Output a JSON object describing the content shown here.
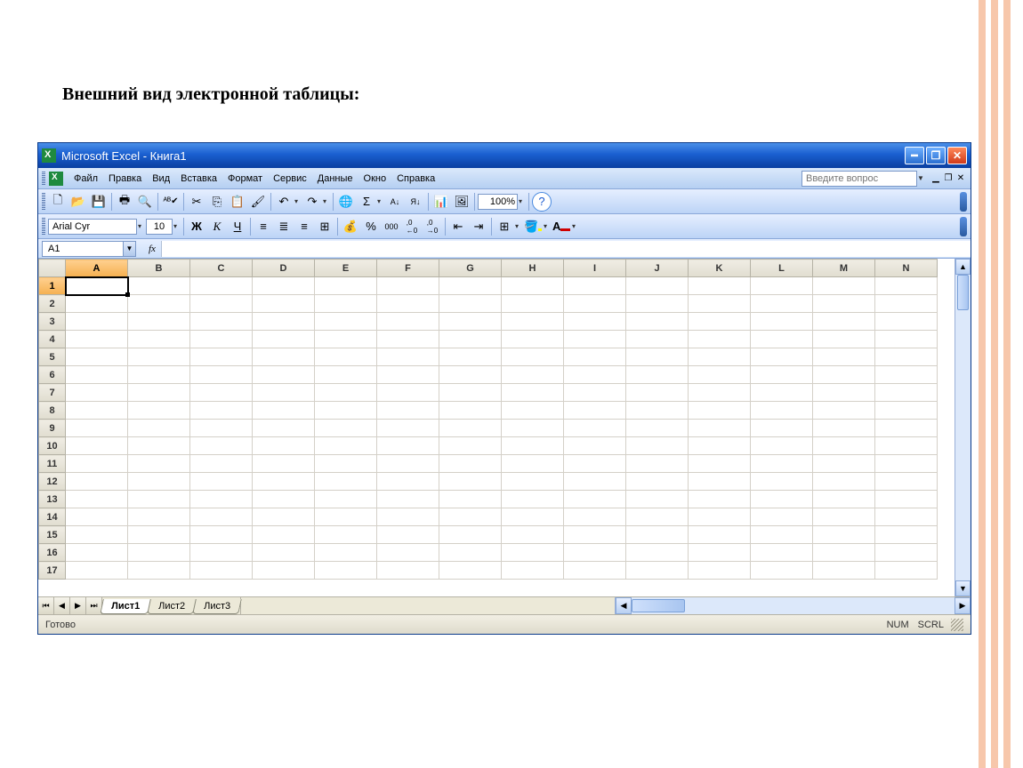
{
  "page_heading": "Внешний вид электронной таблицы:",
  "window": {
    "title": "Microsoft Excel - Книга1"
  },
  "menus": {
    "file": "Файл",
    "edit": "Правка",
    "view": "Вид",
    "insert": "Вставка",
    "format": "Формат",
    "tools": "Сервис",
    "data": "Данные",
    "window": "Окно",
    "help": "Справка"
  },
  "help_placeholder": "Введите вопрос",
  "standard_toolbar": {
    "zoom": "100%"
  },
  "formatting_toolbar": {
    "font_name": "Arial Cyr",
    "font_size": "10",
    "bold": "Ж",
    "italic": "К",
    "underline": "Ч",
    "percent": "%",
    "thousands": "000",
    "inc_dec_1": ",0←",
    "inc_dec_2": "→,0"
  },
  "name_box": "A1",
  "columns": [
    "A",
    "B",
    "C",
    "D",
    "E",
    "F",
    "G",
    "H",
    "I",
    "J",
    "K",
    "L",
    "M",
    "N"
  ],
  "rows": [
    "1",
    "2",
    "3",
    "4",
    "5",
    "6",
    "7",
    "8",
    "9",
    "10",
    "11",
    "12",
    "13",
    "14",
    "15",
    "16",
    "17"
  ],
  "active_cell": {
    "col": 0,
    "row": 0
  },
  "sheets": {
    "active": "Лист1",
    "others": [
      "Лист2",
      "Лист3"
    ]
  },
  "status": {
    "ready": "Готово",
    "num": "NUM",
    "scrl": "SCRL"
  }
}
